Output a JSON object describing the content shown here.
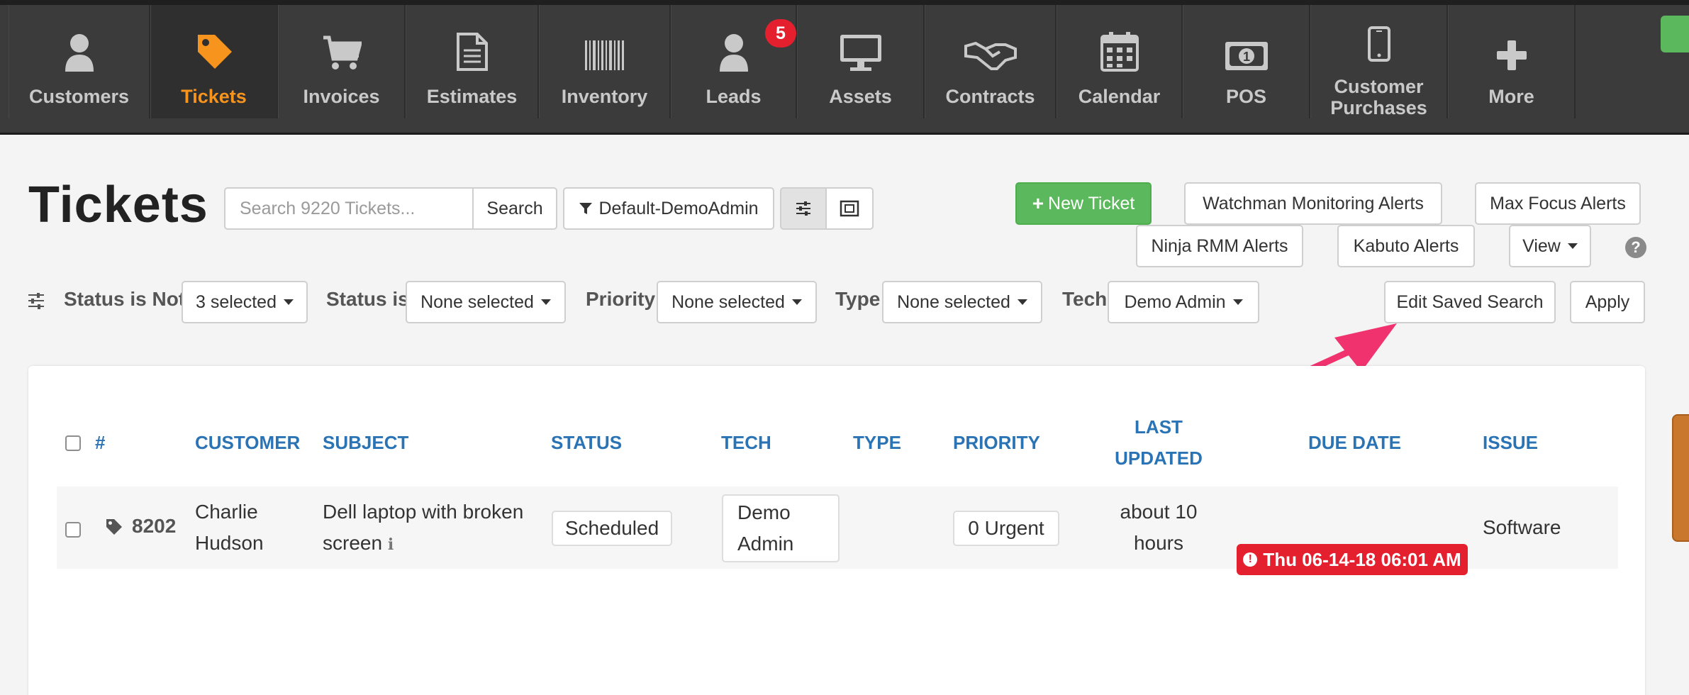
{
  "nav": {
    "items": [
      {
        "label": "Customers",
        "icon": "user-icon"
      },
      {
        "label": "Tickets",
        "icon": "tag-icon",
        "active": true
      },
      {
        "label": "Invoices",
        "icon": "cart-icon"
      },
      {
        "label": "Estimates",
        "icon": "document-icon"
      },
      {
        "label": "Inventory",
        "icon": "barcode-icon"
      },
      {
        "label": "Leads",
        "icon": "user-icon",
        "badge": "5"
      },
      {
        "label": "Assets",
        "icon": "monitor-icon"
      },
      {
        "label": "Contracts",
        "icon": "handshake-icon"
      },
      {
        "label": "Calendar",
        "icon": "calendar-icon"
      },
      {
        "label": "POS",
        "icon": "money-icon"
      },
      {
        "label": "Customer\nPurchases",
        "icon": "phone-icon"
      },
      {
        "label": "More",
        "icon": "plus-icon"
      }
    ],
    "colors": {
      "bar": "#3b3b3b",
      "active": "#f7941d",
      "badge": "#e5202e"
    }
  },
  "page": {
    "title": "Tickets"
  },
  "toolbar": {
    "search_placeholder": "Search 9220 Tickets...",
    "search_button": "Search",
    "saved_search": "Default-DemoAdmin",
    "new_ticket": "New Ticket",
    "watchman": "Watchman Monitoring Alerts",
    "max_focus": "Max Focus Alerts",
    "ninja": "Ninja RMM Alerts",
    "kabuto": "Kabuto Alerts",
    "view": "View",
    "help": "?"
  },
  "filters": {
    "status_not_label": "Status is Not",
    "status_not_value": "3 selected",
    "status_is_label": "Status is",
    "status_is_value": "None selected",
    "priority_label": "Priority",
    "priority_value": "None selected",
    "type_label": "Type",
    "type_value": "None selected",
    "tech_label": "Tech",
    "tech_value": "Demo Admin",
    "edit_saved_search": "Edit Saved Search",
    "apply": "Apply"
  },
  "table": {
    "headers": {
      "number": "#",
      "customer": "CUSTOMER",
      "subject": "SUBJECT",
      "status": "STATUS",
      "tech": "TECH",
      "type": "TYPE",
      "priority": "PRIORITY",
      "last_updated_1": "LAST",
      "last_updated_2": "UPDATED",
      "due_date": "DUE DATE",
      "issue": "ISSUE"
    },
    "rows": [
      {
        "number": "8202",
        "customer_1": "Charlie",
        "customer_2": "Hudson",
        "subject_1": "Dell laptop with broken",
        "subject_2": "screen",
        "status": "Scheduled",
        "tech_1": "Demo",
        "tech_2": "Admin",
        "type": "",
        "priority": "0 Urgent",
        "last_updated_1": "about 10",
        "last_updated_2": "hours",
        "due_date": "Thu 06-14-18 06:01 AM",
        "issue": "Software"
      }
    ]
  },
  "annotation": {
    "arrow_color": "#f0336f"
  }
}
